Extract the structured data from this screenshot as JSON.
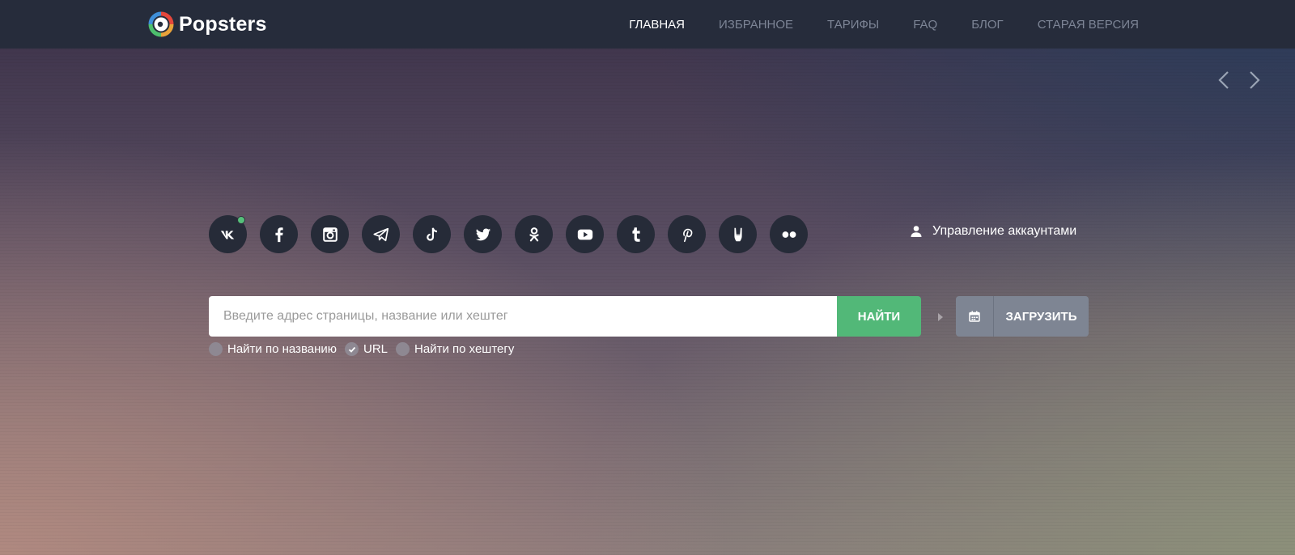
{
  "brand": {
    "name": "Popsters"
  },
  "nav": {
    "items": [
      {
        "label": "ГЛАВНАЯ",
        "active": true
      },
      {
        "label": "ИЗБРАННОЕ"
      },
      {
        "label": "ТАРИФЫ"
      },
      {
        "label": "FAQ"
      },
      {
        "label": "БЛОГ"
      },
      {
        "label": "СТАРАЯ ВЕРСИЯ"
      }
    ]
  },
  "slider": {
    "prev_icon": "chevron-left-icon",
    "next_icon": "chevron-right-icon"
  },
  "socials": [
    {
      "icon": "vk-icon",
      "online": true
    },
    {
      "icon": "facebook-icon"
    },
    {
      "icon": "instagram-icon"
    },
    {
      "icon": "telegram-icon"
    },
    {
      "icon": "tiktok-icon"
    },
    {
      "icon": "twitter-icon"
    },
    {
      "icon": "odnoklassniki-icon"
    },
    {
      "icon": "youtube-icon"
    },
    {
      "icon": "tumblr-icon"
    },
    {
      "icon": "pinterest-icon"
    },
    {
      "icon": "rock-hand-icon"
    },
    {
      "icon": "flickr-icon"
    }
  ],
  "accounts": {
    "label": "Управление аккаунтами",
    "icon": "user-icon"
  },
  "search": {
    "placeholder": "Введите адрес страницы, название или хештег",
    "value": "",
    "button": "НАЙТИ"
  },
  "upload": {
    "label": "ЗАГРУЗИТЬ",
    "icon": "calendar-icon"
  },
  "options": [
    {
      "label": "Найти по названию",
      "checked": false
    },
    {
      "label": "URL",
      "checked": true
    },
    {
      "label": "Найти по хештегу",
      "checked": false
    }
  ],
  "colors": {
    "topbar": "#262c3b",
    "accent_green": "#52b878",
    "online_dot": "#55c07a",
    "social_bg": "#262b38",
    "nav_inactive": "#7d8596"
  }
}
